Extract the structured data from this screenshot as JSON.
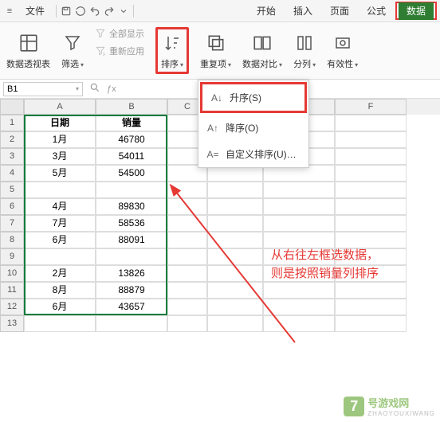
{
  "menubar": {
    "menu_icon": "≡",
    "file": "文件",
    "start": "开始",
    "insert": "插入",
    "page": "页面",
    "formula": "公式",
    "data": "数据"
  },
  "ribbon": {
    "pivot": "数据透视表",
    "filter": "筛选",
    "show_all": "全部显示",
    "reapply": "重新应用",
    "sort": "排序",
    "dup": "重复项",
    "compare": "数据对比",
    "split": "分列",
    "valid": "有效性"
  },
  "namebox": "B1",
  "dropdown": {
    "asc": "升序(S)",
    "desc": "降序(O)",
    "custom": "自定义排序(U)…"
  },
  "col_headers": [
    "A",
    "B",
    "C",
    "D",
    "E",
    "F"
  ],
  "row_headers": [
    "1",
    "2",
    "3",
    "4",
    "5",
    "6",
    "7",
    "8",
    "9",
    "10",
    "11",
    "12",
    "13"
  ],
  "table": {
    "h1": "日期",
    "h2": "销量",
    "r2a": "1月",
    "r2b": "46780",
    "r3a": "3月",
    "r3b": "54011",
    "r4a": "5月",
    "r4b": "54500",
    "r5a": "",
    "r5b": "",
    "r6a": "4月",
    "r6b": "89830",
    "r7a": "7月",
    "r7b": "58536",
    "r8a": "6月",
    "r8b": "88091",
    "r9a": "",
    "r9b": "",
    "r10a": "2月",
    "r10b": "13826",
    "r11a": "8月",
    "r11b": "88879",
    "r12a": "6月",
    "r12b": "43657"
  },
  "annotation": {
    "line1": "从右往左框选数据，",
    "line2": "则是按照销量列排序"
  },
  "watermark": {
    "num": "7",
    "brand": "号游戏网",
    "sub": "ZHAOYOUXIWANG"
  }
}
